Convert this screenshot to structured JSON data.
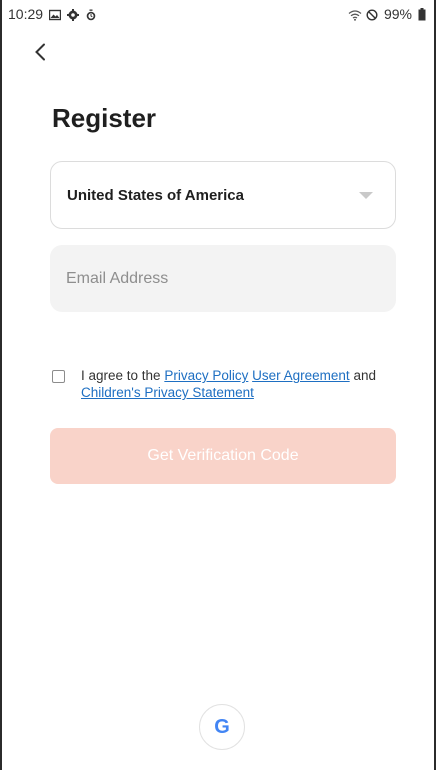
{
  "status_bar": {
    "time": "10:29",
    "battery": "99%",
    "left_icons": [
      "image-icon",
      "settings-icon",
      "alarm-icon"
    ],
    "right_icons": [
      "wifi-icon",
      "do-not-disturb-icon",
      "battery-icon"
    ]
  },
  "header": {
    "back_icon": "chevron-left-icon",
    "title": "Register"
  },
  "form": {
    "country": "United States of America",
    "email_placeholder": "Email Address",
    "agreement": {
      "prefix": "I agree to the",
      "privacy_policy": "Privacy Policy",
      "user_agreement": "User Agreement",
      "and": "and",
      "childrens_statement": "Children's Privacy Statement"
    },
    "submit_label": "Get Verification Code"
  },
  "social": {
    "google_label": "G"
  },
  "colors": {
    "accent_disabled": "#f9d3c9",
    "link": "#1e6fc2",
    "field_bg": "#f3f3f3"
  }
}
